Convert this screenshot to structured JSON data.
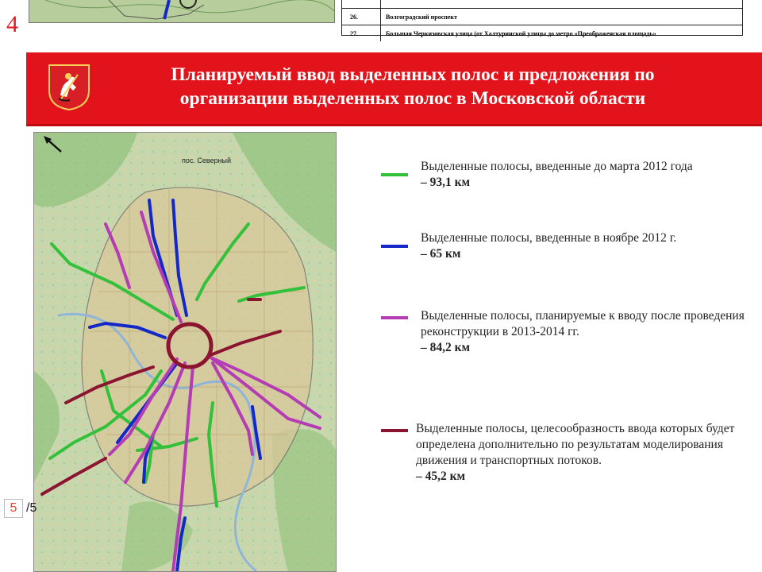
{
  "previous_slide": {
    "page_number": "4",
    "table_rows": [
      {
        "num": "",
        "text": ""
      },
      {
        "num": "26.",
        "text": "Волгоградский проспект"
      },
      {
        "num": "27.",
        "text": "Большая Черкизовская улица (от Халтуринской улицы до метро «Преображенская площадь»"
      }
    ]
  },
  "header": {
    "title_line1": "Планируемый ввод выделенных полос и предложения по",
    "title_line2": "организации выделенных полос в Московской области",
    "emblem": "moscow-coat-of-arms-icon"
  },
  "map": {
    "place_label": "пос. Северный",
    "north_arrow": "north-arrow-icon"
  },
  "legend": [
    {
      "color": "#33c13c",
      "text": "Выделенные полосы, введенные до марта 2012 года",
      "amount": "– 93,1 км"
    },
    {
      "color": "#1428c8",
      "text": "Выделенные полосы, введенные в ноябре 2012 г.",
      "amount": "– 65 км"
    },
    {
      "color": "#b43cb4",
      "text": "Выделенные полосы, планируемые к вводу после проведения реконструкции в 2013-2014 гг.",
      "amount": "– 84,2 км"
    },
    {
      "color": "#8b1530",
      "text": "Выделенные полосы, целесообразность ввода которых будет определена дополнительно по результатам моделирования движения и транспортных потоков.",
      "amount": "– 45,2 км"
    }
  ],
  "pager": {
    "current": "5",
    "total": "/5"
  },
  "colors": {
    "banner": "#e3131c",
    "green": "#33c13c",
    "blue": "#1428c8",
    "purple": "#b43cb4",
    "maroon": "#8b1530"
  }
}
